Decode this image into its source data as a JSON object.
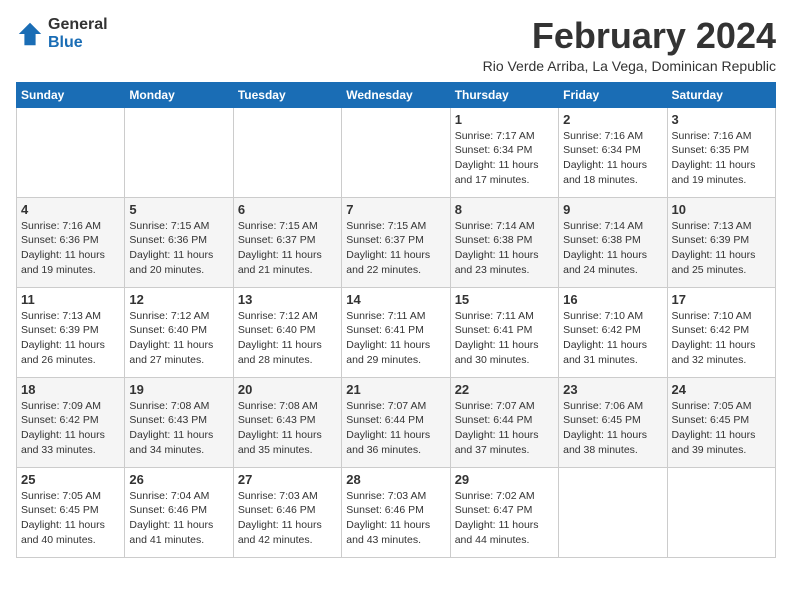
{
  "logo": {
    "general": "General",
    "blue": "Blue"
  },
  "title": "February 2024",
  "subtitle": "Rio Verde Arriba, La Vega, Dominican Republic",
  "weekdays": [
    "Sunday",
    "Monday",
    "Tuesday",
    "Wednesday",
    "Thursday",
    "Friday",
    "Saturday"
  ],
  "weeks": [
    [
      {
        "day": "",
        "sunrise": "",
        "sunset": "",
        "daylight": ""
      },
      {
        "day": "",
        "sunrise": "",
        "sunset": "",
        "daylight": ""
      },
      {
        "day": "",
        "sunrise": "",
        "sunset": "",
        "daylight": ""
      },
      {
        "day": "",
        "sunrise": "",
        "sunset": "",
        "daylight": ""
      },
      {
        "day": "1",
        "sunrise": "7:17 AM",
        "sunset": "6:34 PM",
        "daylight": "11 hours and 17 minutes."
      },
      {
        "day": "2",
        "sunrise": "7:16 AM",
        "sunset": "6:34 PM",
        "daylight": "11 hours and 18 minutes."
      },
      {
        "day": "3",
        "sunrise": "7:16 AM",
        "sunset": "6:35 PM",
        "daylight": "11 hours and 19 minutes."
      }
    ],
    [
      {
        "day": "4",
        "sunrise": "7:16 AM",
        "sunset": "6:36 PM",
        "daylight": "11 hours and 19 minutes."
      },
      {
        "day": "5",
        "sunrise": "7:15 AM",
        "sunset": "6:36 PM",
        "daylight": "11 hours and 20 minutes."
      },
      {
        "day": "6",
        "sunrise": "7:15 AM",
        "sunset": "6:37 PM",
        "daylight": "11 hours and 21 minutes."
      },
      {
        "day": "7",
        "sunrise": "7:15 AM",
        "sunset": "6:37 PM",
        "daylight": "11 hours and 22 minutes."
      },
      {
        "day": "8",
        "sunrise": "7:14 AM",
        "sunset": "6:38 PM",
        "daylight": "11 hours and 23 minutes."
      },
      {
        "day": "9",
        "sunrise": "7:14 AM",
        "sunset": "6:38 PM",
        "daylight": "11 hours and 24 minutes."
      },
      {
        "day": "10",
        "sunrise": "7:13 AM",
        "sunset": "6:39 PM",
        "daylight": "11 hours and 25 minutes."
      }
    ],
    [
      {
        "day": "11",
        "sunrise": "7:13 AM",
        "sunset": "6:39 PM",
        "daylight": "11 hours and 26 minutes."
      },
      {
        "day": "12",
        "sunrise": "7:12 AM",
        "sunset": "6:40 PM",
        "daylight": "11 hours and 27 minutes."
      },
      {
        "day": "13",
        "sunrise": "7:12 AM",
        "sunset": "6:40 PM",
        "daylight": "11 hours and 28 minutes."
      },
      {
        "day": "14",
        "sunrise": "7:11 AM",
        "sunset": "6:41 PM",
        "daylight": "11 hours and 29 minutes."
      },
      {
        "day": "15",
        "sunrise": "7:11 AM",
        "sunset": "6:41 PM",
        "daylight": "11 hours and 30 minutes."
      },
      {
        "day": "16",
        "sunrise": "7:10 AM",
        "sunset": "6:42 PM",
        "daylight": "11 hours and 31 minutes."
      },
      {
        "day": "17",
        "sunrise": "7:10 AM",
        "sunset": "6:42 PM",
        "daylight": "11 hours and 32 minutes."
      }
    ],
    [
      {
        "day": "18",
        "sunrise": "7:09 AM",
        "sunset": "6:42 PM",
        "daylight": "11 hours and 33 minutes."
      },
      {
        "day": "19",
        "sunrise": "7:08 AM",
        "sunset": "6:43 PM",
        "daylight": "11 hours and 34 minutes."
      },
      {
        "day": "20",
        "sunrise": "7:08 AM",
        "sunset": "6:43 PM",
        "daylight": "11 hours and 35 minutes."
      },
      {
        "day": "21",
        "sunrise": "7:07 AM",
        "sunset": "6:44 PM",
        "daylight": "11 hours and 36 minutes."
      },
      {
        "day": "22",
        "sunrise": "7:07 AM",
        "sunset": "6:44 PM",
        "daylight": "11 hours and 37 minutes."
      },
      {
        "day": "23",
        "sunrise": "7:06 AM",
        "sunset": "6:45 PM",
        "daylight": "11 hours and 38 minutes."
      },
      {
        "day": "24",
        "sunrise": "7:05 AM",
        "sunset": "6:45 PM",
        "daylight": "11 hours and 39 minutes."
      }
    ],
    [
      {
        "day": "25",
        "sunrise": "7:05 AM",
        "sunset": "6:45 PM",
        "daylight": "11 hours and 40 minutes."
      },
      {
        "day": "26",
        "sunrise": "7:04 AM",
        "sunset": "6:46 PM",
        "daylight": "11 hours and 41 minutes."
      },
      {
        "day": "27",
        "sunrise": "7:03 AM",
        "sunset": "6:46 PM",
        "daylight": "11 hours and 42 minutes."
      },
      {
        "day": "28",
        "sunrise": "7:03 AM",
        "sunset": "6:46 PM",
        "daylight": "11 hours and 43 minutes."
      },
      {
        "day": "29",
        "sunrise": "7:02 AM",
        "sunset": "6:47 PM",
        "daylight": "11 hours and 44 minutes."
      },
      {
        "day": "",
        "sunrise": "",
        "sunset": "",
        "daylight": ""
      },
      {
        "day": "",
        "sunrise": "",
        "sunset": "",
        "daylight": ""
      }
    ]
  ],
  "labels": {
    "sunrise": "Sunrise:",
    "sunset": "Sunset:",
    "daylight": "Daylight:"
  }
}
